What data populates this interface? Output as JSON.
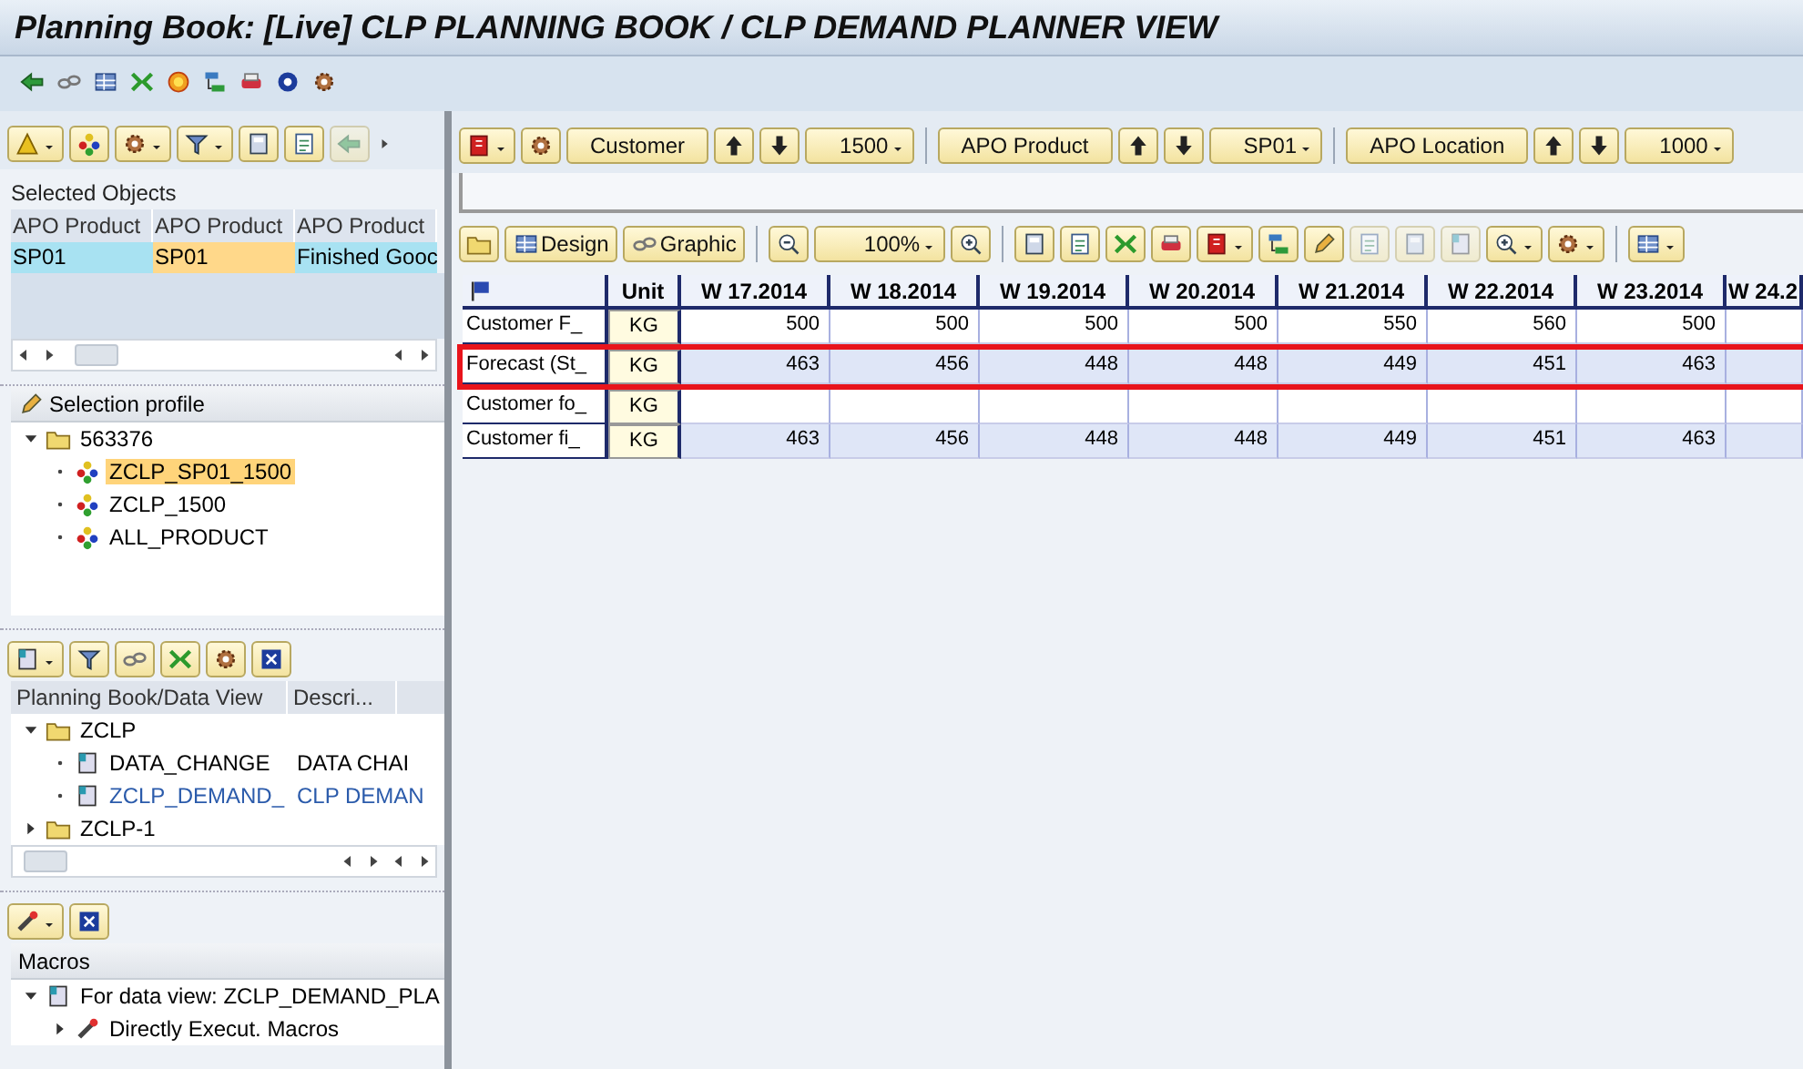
{
  "window": {
    "title": "Planning Book: [Live] CLP PLANNING BOOK / CLP DEMAND PLANNER VIEW"
  },
  "selected_objects": {
    "title": "Selected Objects",
    "columns": [
      "APO Product",
      "APO Product",
      "APO Product"
    ],
    "rows": [
      {
        "cells": [
          {
            "text": "SP01",
            "selected": false
          },
          {
            "text": "SP01",
            "selected": true
          },
          {
            "text": "Finished Gooc",
            "selected": false
          }
        ]
      }
    ]
  },
  "selection_profile": {
    "title": "Selection profile",
    "tree": [
      {
        "label": "563376",
        "expanded": true,
        "children": [
          {
            "label": "ZCLP_SP01_1500",
            "selected": true
          },
          {
            "label": "ZCLP_1500",
            "selected": false
          },
          {
            "label": "ALL_PRODUCT",
            "selected": false
          }
        ]
      }
    ]
  },
  "planning_books": {
    "columns": [
      "Planning Book/Data View",
      "Descri..."
    ],
    "tree": [
      {
        "label": "ZCLP",
        "expanded": true,
        "selected": false,
        "children": [
          {
            "label": "DATA_CHANGE",
            "description": "DATA CHAI",
            "selected": false
          },
          {
            "label": "ZCLP_DEMAND_",
            "description": "CLP DEMAN",
            "selected": true
          }
        ]
      },
      {
        "label": "ZCLP-1",
        "expanded": false,
        "selected": false
      }
    ]
  },
  "macros": {
    "title": "Macros",
    "tree": [
      {
        "label": "For data view: ZCLP_DEMAND_PLA",
        "expanded": true,
        "children": [
          {
            "label": "Directly Execut. Macros",
            "expanded": false
          }
        ]
      }
    ]
  },
  "characteristics": [
    {
      "name": "Customer",
      "value": "1500"
    },
    {
      "name": "APO Product",
      "value": "SP01"
    },
    {
      "name": "APO Location",
      "value": "1000"
    }
  ],
  "grid_toolbar": {
    "design": "Design",
    "graphic": "Graphic",
    "zoom": "100%"
  },
  "grid": {
    "columns": [
      "Unit",
      "W 17.2014",
      "W 18.2014",
      "W 19.2014",
      "W 20.2014",
      "W 21.2014",
      "W 22.2014",
      "W 23.2014",
      "W 24.2"
    ],
    "rows": [
      {
        "label": "Customer F_",
        "unit": "KG",
        "highlighted": false,
        "values": [
          "500",
          "500",
          "500",
          "500",
          "550",
          "560",
          "500"
        ]
      },
      {
        "label": "Forecast (St_",
        "unit": "KG",
        "highlighted": true,
        "values": [
          "463",
          "456",
          "448",
          "448",
          "449",
          "451",
          "463"
        ]
      },
      {
        "label": "Customer fo_",
        "unit": "KG",
        "highlighted": false
      },
      {
        "label": "Customer fi_",
        "unit": "KG",
        "highlighted": false,
        "values": [
          "463",
          "456",
          "448",
          "448",
          "449",
          "451",
          "463"
        ]
      }
    ]
  }
}
